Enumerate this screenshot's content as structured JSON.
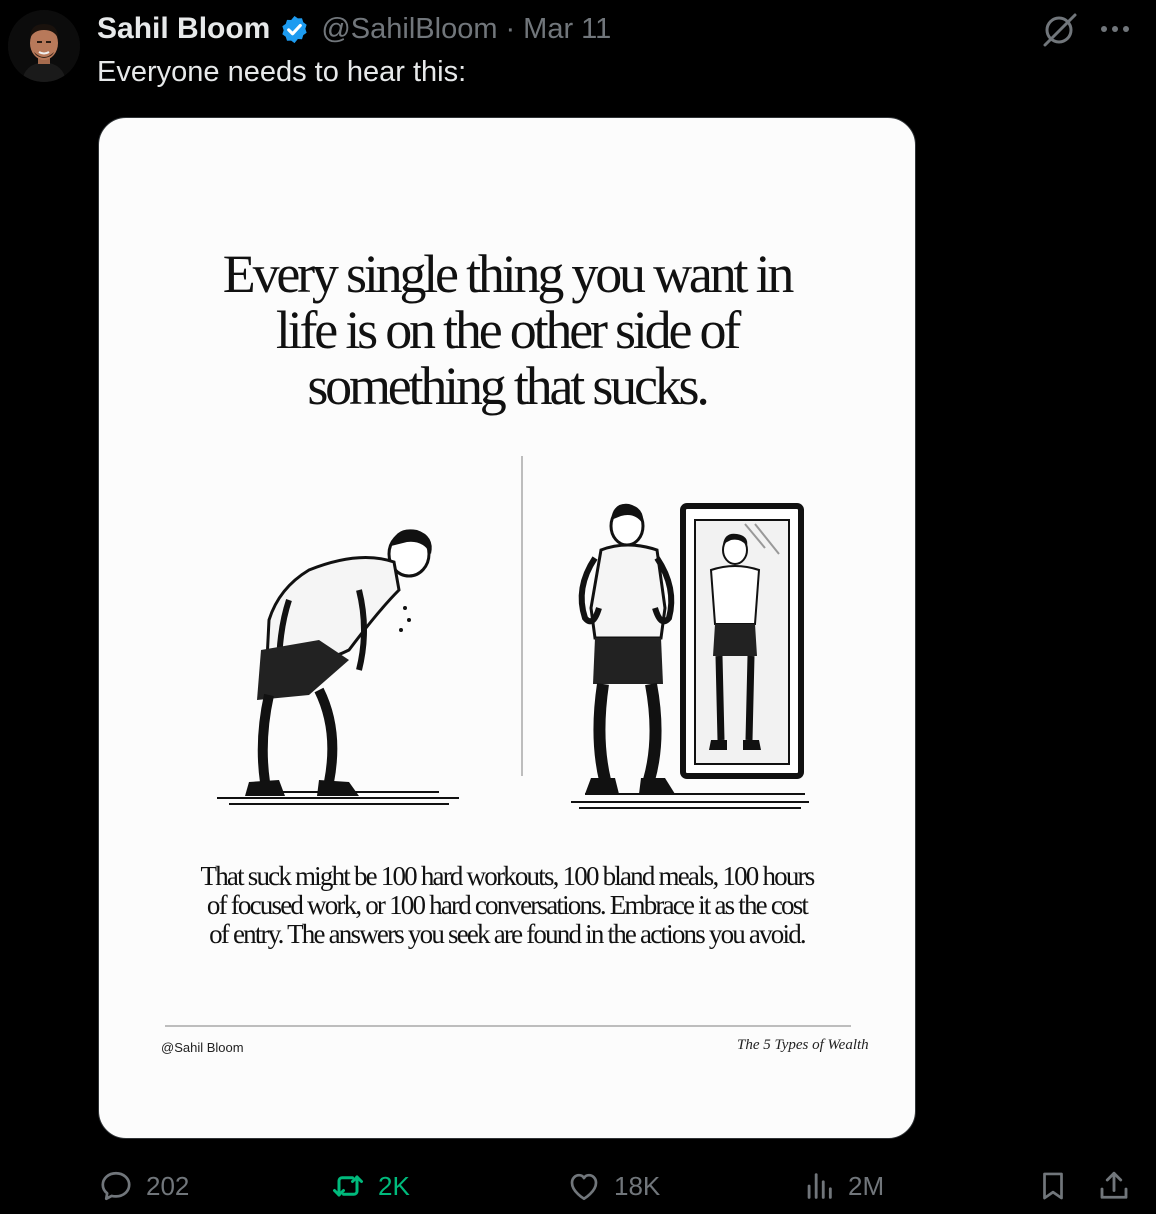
{
  "tweet": {
    "author_name": "Sahil Bloom",
    "handle": "@SahilBloom",
    "separator": "·",
    "date": "Mar 11",
    "text": "Everyone needs to hear this:"
  },
  "card": {
    "headline": "Every single thing you want in\nlife is on the other side of\nsomething that sucks.",
    "body": "That suck might be 100 hard workouts, 100 bland meals, 100 hours\nof focused work, or 100 hard conversations. Embrace it as the cost\nof entry. The answers you seek are found in the actions you avoid.",
    "credit": "@Sahil Bloom",
    "brand": "The 5 Types of Wealth"
  },
  "actions": {
    "replies": "202",
    "reposts": "2K",
    "likes": "18K",
    "views": "2M"
  },
  "colors": {
    "background": "#000000",
    "text": "#e7e9ea",
    "muted": "#71767b",
    "verified": "#1d9bf0",
    "repost_active": "#00ba7c"
  }
}
